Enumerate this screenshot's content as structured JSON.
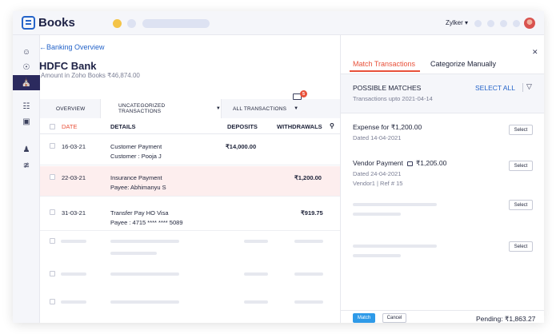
{
  "app": {
    "name": "Books",
    "org": "Zylker ▾"
  },
  "nav": {
    "back_label": "←Banking Overview"
  },
  "account": {
    "name": "HDFC Bank",
    "amount_label": "Amount in Zoho Books  ₹46,874.00"
  },
  "tabs": {
    "overview": "OVERVIEW",
    "uncategorized": "UNCATEGORIZED TRANSACTIONS",
    "all": "ALL TRANSACTIONS",
    "badge_count": "5"
  },
  "table": {
    "headers": {
      "date": "DATE",
      "details": "DETAILS",
      "deposits": "DEPOSITS",
      "withdrawals": "WITHDRAWALS"
    },
    "rows": [
      {
        "date": "16-03-21",
        "line1": "Customer Payment",
        "line2": "Customer : Pooja J",
        "deposit": "₹14,000.00",
        "withdrawal": ""
      },
      {
        "date": "22-03-21",
        "line1": "Insurance Payment",
        "line2": "Payee: Abhimanyu S",
        "deposit": "",
        "withdrawal": "₹1,200.00"
      },
      {
        "date": "31-03-21",
        "line1": "Transfer Pay HO Visa",
        "line2": "Payee : 4715 **** **** 5089",
        "deposit": "",
        "withdrawal": "₹919.75"
      }
    ]
  },
  "panel": {
    "tab_match": "Match Transactions",
    "tab_categorize": "Categorize Manually",
    "close": "✕",
    "possible_matches": "POSSIBLE MATCHES",
    "upto": "Transactions upto 2021-04-14",
    "select_all": "SELECT ALL",
    "matches": [
      {
        "title": "Expense for ₹1,200.00",
        "sub1": "Dated 14-04-2021",
        "sub2": ""
      },
      {
        "title_a": "Vendor Payment",
        "title_b": "₹1,205.00",
        "sub1": "Dated 24-04-2021",
        "sub2": "Vendor1 | Ref # 15"
      }
    ],
    "select_label": "Select",
    "match_button": "Match",
    "cancel_button": "Cancel",
    "pending": "Pending: ₹1,863.27"
  },
  "colors": {
    "accent": "#e8513a",
    "brand": "#2564c9",
    "nav_active": "#2b2a5e",
    "highlight_row": "#fdeeee"
  }
}
